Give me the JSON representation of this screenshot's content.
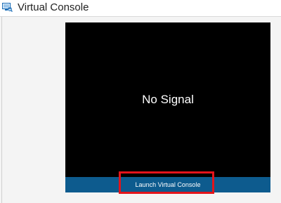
{
  "header": {
    "title": "Virtual Console",
    "icon": "console-monitor-icon"
  },
  "console": {
    "status_text": "No Signal",
    "launch_label": "Launch Virtual Console"
  },
  "colors": {
    "screen_background": "#000000",
    "launch_bar": "#0d5b8e",
    "highlight": "#e3141b",
    "icon_accent": "#1d6fb8"
  }
}
